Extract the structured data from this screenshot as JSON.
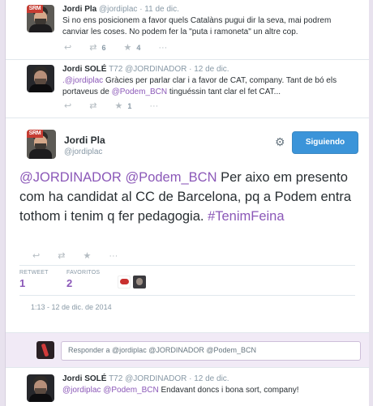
{
  "tweets": {
    "t1": {
      "name": "Jordi Pla",
      "meta": "@jordiplac · 11 de dic.",
      "text": "Si no ens posicionem a favor quels Catalàns pugui dir la seva, mai podrem canviar les coses. No podem fer la \"puta i ramoneta\" un altre cop.",
      "retweets": "6",
      "favorites": "4"
    },
    "t2": {
      "name": "Jordi SOLÉ",
      "meta": "T72 @JORDINADOR · 12 de dic.",
      "mention1": ".@jordiplac",
      "text_a": " Gràcies per parlar clar i a favor de CAT, company. Tant de bó els portaveus de ",
      "mention2": "@Podem_BCN",
      "text_b": " tinguéssin tant clar el fet CAT...",
      "favorites": "1"
    },
    "main": {
      "name": "Jordi Pla",
      "handle": "@jordiplac",
      "follow_label": "Siguiendo",
      "mention1": "@JORDINADOR",
      "mention2": "@Podem_BCN",
      "text": " Per aixo em presento com ha candidat al CC de Barcelona, pq a Podem entra tothom i tenim q fer pedagogia. ",
      "hashtag": "#TenimFeina",
      "retweet_label": "RETWEET",
      "retweet_count": "1",
      "favorites_label": "FAVORITOS",
      "favorites_count": "2",
      "timestamp": "1:13 - 12 de dic. de 2014"
    },
    "reply": {
      "placeholder": "Responder a @jordiplac @JORDINADOR @Podem_BCN"
    },
    "t3": {
      "name": "Jordi SOLÉ",
      "meta": "T72 @JORDINADOR · 12 de dic.",
      "mention1": "@jordiplac",
      "mention2": "@Podem_BCN",
      "text": " Endavant doncs i bona sort, company!"
    }
  },
  "icons": {
    "reply": "reply-icon",
    "retweet": "retweet-icon",
    "favorite": "star-icon",
    "more": "more-icon",
    "settings": "gear-icon"
  },
  "colors": {
    "link": "#8b58b8",
    "follow_button": "#3b94d9",
    "reply_bg": "#f1eaf6"
  }
}
